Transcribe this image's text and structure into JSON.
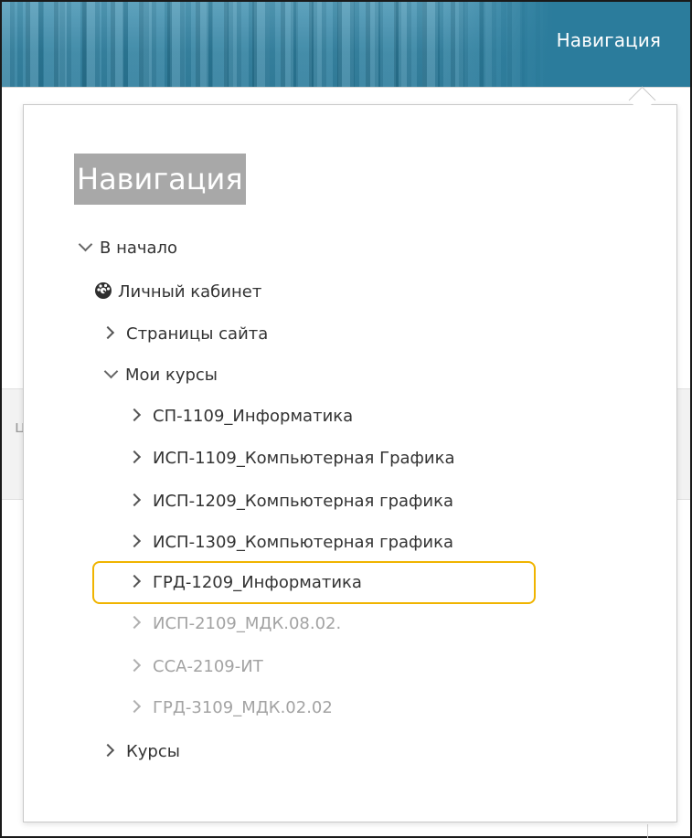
{
  "header": {
    "nav_link": "Навигация"
  },
  "background": {
    "partial_letter": "ц"
  },
  "popover": {
    "title": "Навигация",
    "home": "В начало",
    "dashboard": {
      "label": "Личный кабинет",
      "icon": "dashboard-icon"
    },
    "site_pages": "Страницы сайта",
    "my_courses": "Мои курсы",
    "courses": [
      {
        "label": "СП-1109_Информатика",
        "muted": false
      },
      {
        "label": "ИСП-1109_Компьютерная Графика",
        "muted": false
      },
      {
        "label": "ИСП-1209_Компьютерная графика",
        "muted": false
      },
      {
        "label": "ИСП-1309_Компьютерная графика",
        "muted": false
      },
      {
        "label": "ГРД-1209_Информатика",
        "muted": false,
        "highlighted": true
      },
      {
        "label": "ИСП-2109_МДК.08.02.",
        "muted": true
      },
      {
        "label": "ССА-2109-ИТ",
        "muted": true
      },
      {
        "label": "ГРД-3109_МДК.02.02",
        "muted": true
      }
    ],
    "courses_root": "Курсы"
  },
  "colors": {
    "header_blue": "#2b7c9c",
    "highlight_outline": "#f0b400",
    "title_bg": "#a8a8a8"
  }
}
